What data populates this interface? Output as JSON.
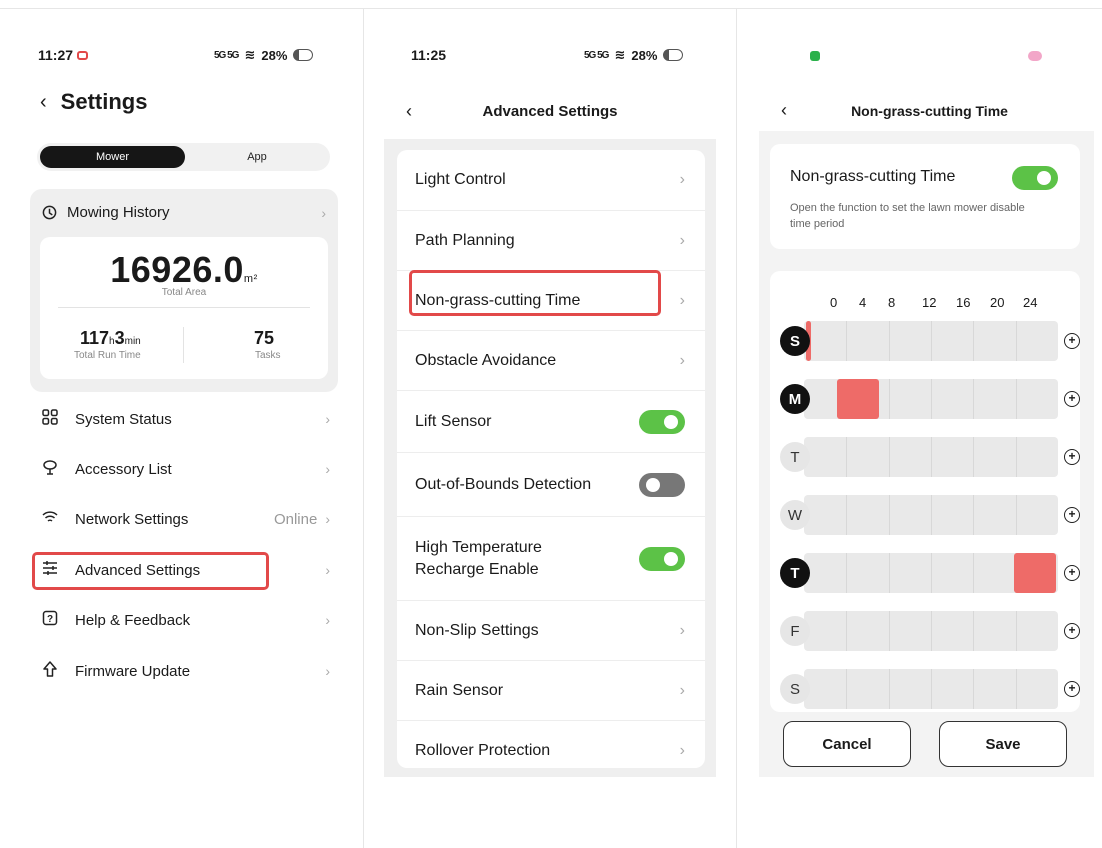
{
  "panel1": {
    "status": {
      "time": "11:27",
      "signal": "5G 5G",
      "battery": "28%"
    },
    "title": "Settings",
    "segments": {
      "active": "Mower",
      "inactive": "App"
    },
    "mowing_history": {
      "label": "Mowing History",
      "total_area_value": "16926.0",
      "total_area_unit": "m²",
      "total_area_label": "Total Area",
      "run_time_hours": "117",
      "run_time_h_unit": "h",
      "run_time_minutes": "3",
      "run_time_min_unit": "min",
      "run_time_label": "Total Run Time",
      "tasks_value": "75",
      "tasks_label": "Tasks"
    },
    "menu": [
      {
        "label": "System Status",
        "icon": "grid-icon"
      },
      {
        "label": "Accessory List",
        "icon": "accessory-icon"
      },
      {
        "label": "Network Settings",
        "icon": "wifi-icon",
        "status": "Online"
      },
      {
        "label": "Advanced Settings",
        "icon": "sliders-icon"
      },
      {
        "label": "Help & Feedback",
        "icon": "help-icon"
      },
      {
        "label": "Firmware Update",
        "icon": "upload-icon"
      }
    ]
  },
  "panel2": {
    "status": {
      "time": "11:25",
      "signal": "5G 5G",
      "battery": "28%"
    },
    "title": "Advanced Settings",
    "items": [
      {
        "label": "Light Control",
        "type": "link"
      },
      {
        "label": "Path Planning",
        "type": "link"
      },
      {
        "label": "Non-grass-cutting Time",
        "type": "link"
      },
      {
        "label": "Obstacle Avoidance",
        "type": "link"
      },
      {
        "label": "Lift Sensor",
        "type": "toggle",
        "on": true
      },
      {
        "label": "Out-of-Bounds Detection",
        "type": "toggle",
        "on": false
      },
      {
        "label": "High Temperature Recharge Enable",
        "line1": "High Temperature",
        "line2": "Recharge Enable",
        "type": "toggle",
        "on": true
      },
      {
        "label": "Non-Slip Settings",
        "type": "link"
      },
      {
        "label": "Rain Sensor",
        "type": "link"
      },
      {
        "label": "Rollover Protection",
        "type": "link"
      }
    ]
  },
  "panel3": {
    "title": "Non-grass-cutting Time",
    "feature": {
      "title": "Non-grass-cutting Time",
      "description": "Open the function to set the lawn mower disable time period",
      "enabled": true
    },
    "hours": [
      "0",
      "4",
      "8",
      "12",
      "16",
      "20",
      "24"
    ],
    "days": [
      {
        "letter": "S",
        "active": true,
        "periods": [
          [
            0,
            0.5
          ]
        ]
      },
      {
        "letter": "M",
        "active": true,
        "periods": [
          [
            3,
            7
          ]
        ]
      },
      {
        "letter": "T",
        "active": false,
        "periods": []
      },
      {
        "letter": "W",
        "active": false,
        "periods": []
      },
      {
        "letter": "T",
        "active": true,
        "periods": [
          [
            20,
            24
          ]
        ]
      },
      {
        "letter": "F",
        "active": false,
        "periods": []
      },
      {
        "letter": "S",
        "active": false,
        "periods": []
      }
    ],
    "cancel_label": "Cancel",
    "save_label": "Save",
    "colors": {
      "accent_red": "#ee6b68",
      "toggle_green": "#5cc247"
    }
  }
}
